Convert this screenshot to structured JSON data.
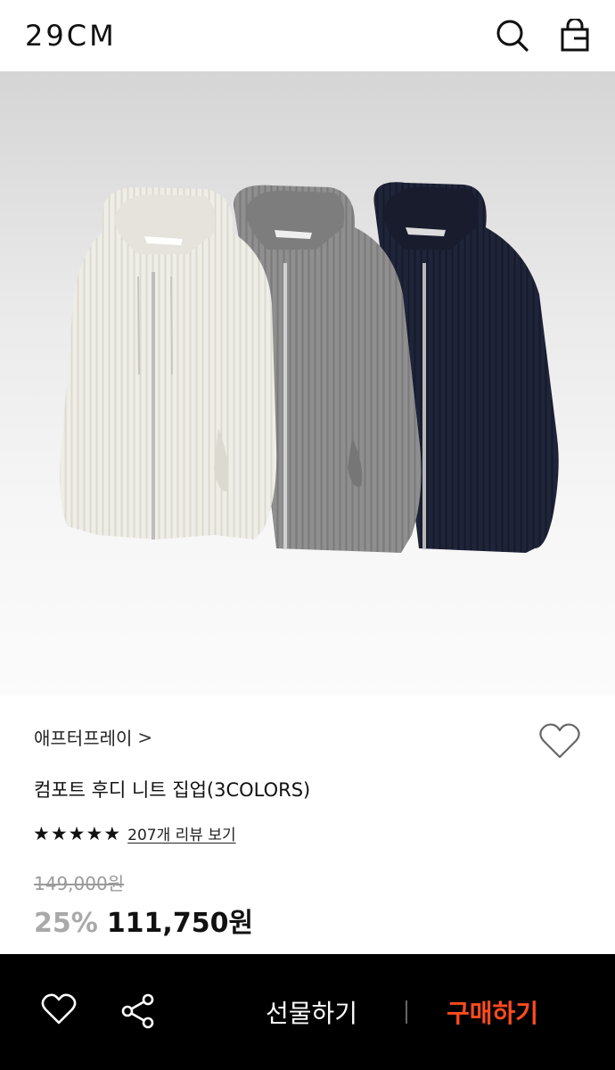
{
  "header": {
    "logo": "29CM",
    "icons": [
      "search-icon",
      "bag-icon"
    ]
  },
  "product": {
    "image_alt": "three zip-up knit hoodies in ivory, grey and navy",
    "brand": "애프터프레이",
    "brand_chevron": ">",
    "title": "컴포트 후디 니트 집업(3COLORS)",
    "rating_stars": 5,
    "review_link": "207개 리뷰 보기",
    "original_price": "149,000원",
    "discount": "25%",
    "price": "111,750원",
    "colors": {
      "ivory": "#eeece6",
      "grey": "#8e8e8e",
      "navy": "#1d2236"
    }
  },
  "bottom_bar": {
    "gift_label": "선물하기",
    "buy_label": "구매하기",
    "buy_color": "#ff4b1f",
    "icons": [
      "heart-icon",
      "share-icon"
    ]
  }
}
